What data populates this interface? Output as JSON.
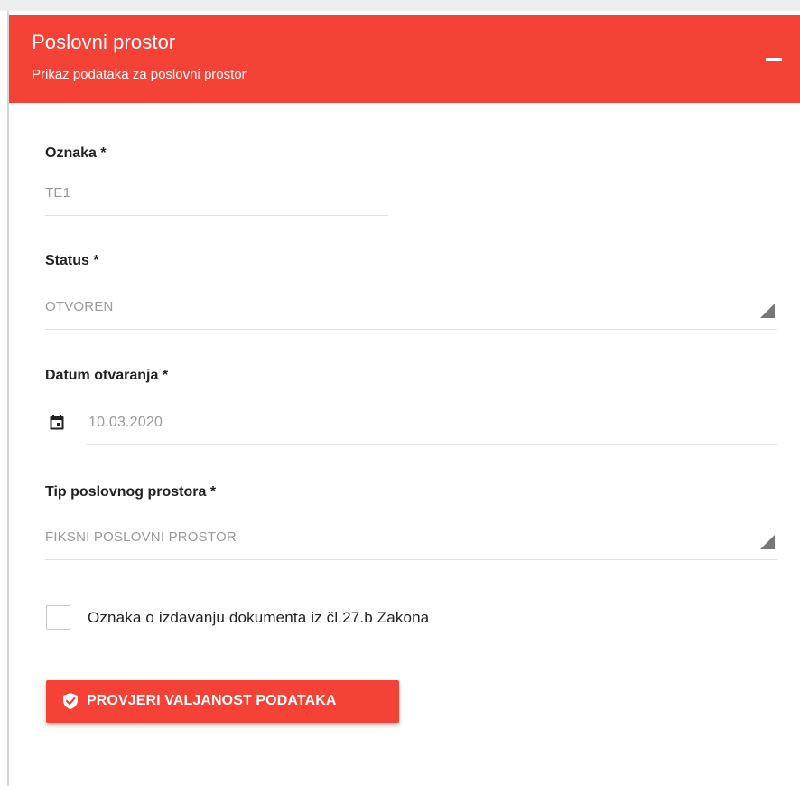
{
  "card": {
    "title": "Poslovni prostor",
    "subtitle": "Prikaz podataka za poslovni prostor",
    "accent_color": "#f44336",
    "collapse_icon": "minus-icon"
  },
  "form": {
    "oznaka": {
      "label": "Oznaka *",
      "value": "TE1"
    },
    "status": {
      "label": "Status *",
      "value": "OTVOREN",
      "icon": "dropdown-arrow-icon"
    },
    "datum": {
      "label": "Datum otvaranja *",
      "value": "10.03.2020",
      "icon": "calendar-icon"
    },
    "tip": {
      "label": "Tip poslovnog prostora *",
      "value": "FIKSNI POSLOVNI PROSTOR",
      "icon": "dropdown-arrow-icon"
    },
    "dokument_checkbox": {
      "label": "Oznaka o izdavanju dokumenta iz čl.27.b Zakona",
      "checked": false
    }
  },
  "actions": {
    "validate": {
      "label": "PROVJERI VALJANOST PODATAKA",
      "icon": "shield-check-icon"
    }
  }
}
